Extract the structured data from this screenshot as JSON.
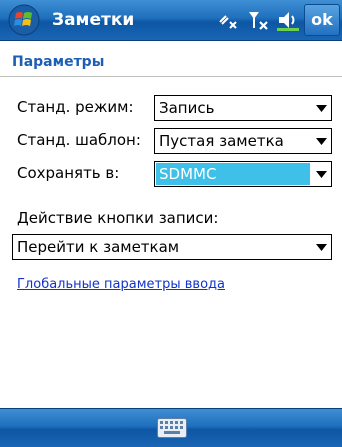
{
  "titlebar": {
    "app_title": "Заметки",
    "ok_label": "ok",
    "icons": [
      "windows-start-icon",
      "connectivity-icon",
      "signal-off-icon",
      "speaker-icon"
    ]
  },
  "page": {
    "heading": "Параметры"
  },
  "settings": {
    "default_mode": {
      "label": "Станд. режим:",
      "value": "Запись"
    },
    "default_template": {
      "label": "Станд. шаблон:",
      "value": "Пустая заметка"
    },
    "save_to": {
      "label": "Сохранять в:",
      "value": "SDMMC"
    },
    "record_button_action": {
      "label": "Действие кнопки записи:",
      "value": "Перейти к заметкам"
    }
  },
  "link": {
    "text": "Глобальные параметры ввода"
  },
  "bottombar": {
    "icons": [
      "keyboard-icon"
    ]
  },
  "colors": {
    "titlebar": "#1e6fbd",
    "heading": "#1d5fb5",
    "selection": "#3fc0e8",
    "link": "#1133cc"
  }
}
